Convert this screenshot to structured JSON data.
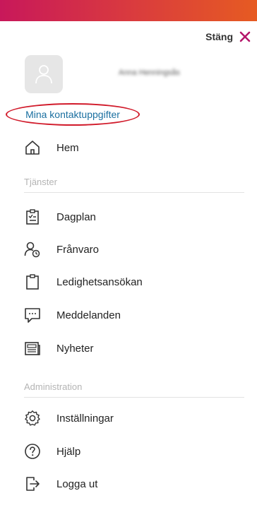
{
  "header": {
    "close_label": "Stäng"
  },
  "profile": {
    "name": "Anna Henningsås",
    "contact_link": "Mina kontaktuppgifter"
  },
  "menu": {
    "home": "Hem",
    "services_title": "Tjänster",
    "services": [
      {
        "label": "Dagplan",
        "icon": "clipboard-check-icon"
      },
      {
        "label": "Frånvaro",
        "icon": "person-clock-icon"
      },
      {
        "label": "Ledighetsansökan",
        "icon": "clipboard-icon"
      },
      {
        "label": "Meddelanden",
        "icon": "chat-icon"
      },
      {
        "label": "Nyheter",
        "icon": "newspaper-icon"
      }
    ],
    "admin_title": "Administration",
    "admin": [
      {
        "label": "Inställningar",
        "icon": "gear-icon"
      },
      {
        "label": "Hjälp",
        "icon": "help-icon"
      },
      {
        "label": "Logga ut",
        "icon": "logout-icon"
      }
    ]
  },
  "colors": {
    "gradient_start": "#c8185a",
    "gradient_end": "#e65b22",
    "close_x": "#b5166a",
    "link": "#1a6fa0",
    "highlight_ring": "#d11a2a"
  }
}
